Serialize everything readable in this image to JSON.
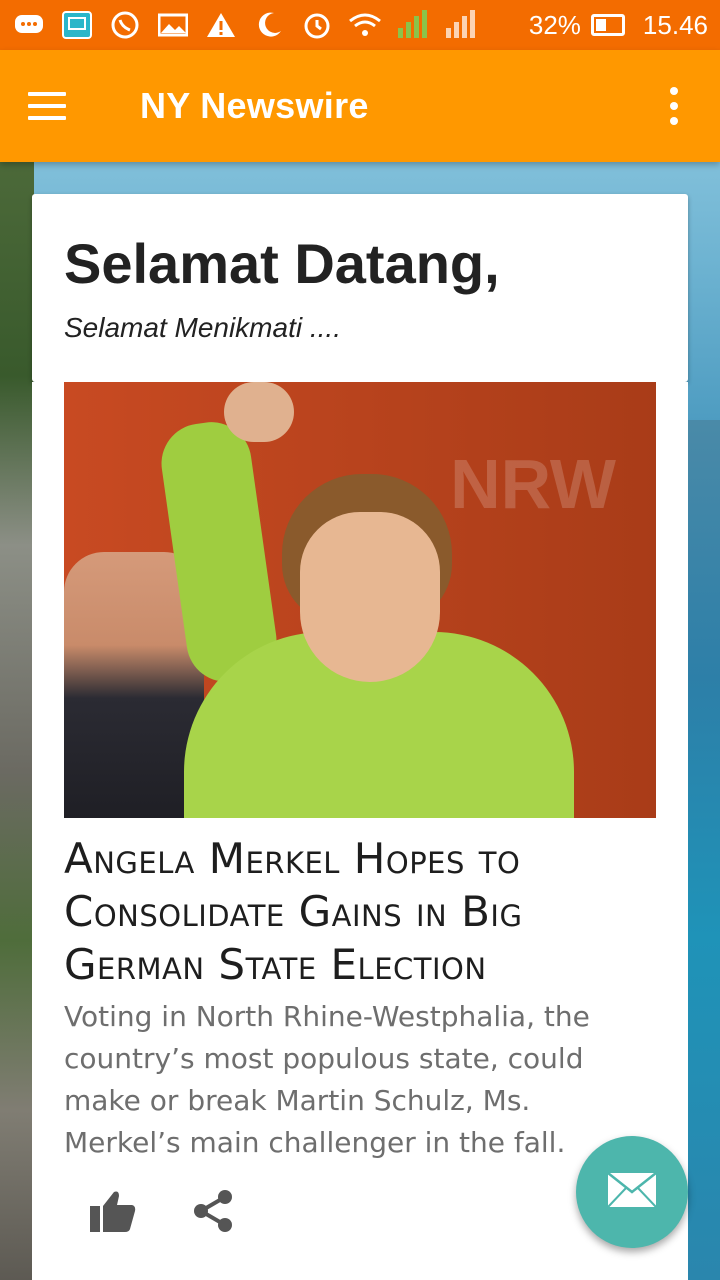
{
  "status_bar": {
    "battery": "32%",
    "time": "15.46",
    "icons": [
      "chat-icon",
      "screen-icon",
      "whatsapp-icon",
      "gallery-icon",
      "warning-icon",
      "moon-icon",
      "alarm-icon",
      "wifi-icon",
      "signal-icon",
      "signal-off-icon",
      "battery-charging-icon"
    ]
  },
  "app_bar": {
    "title": "NY Newswire"
  },
  "welcome": {
    "heading": "Selamat Datang,",
    "subheading": "Selamat Menikmati ...."
  },
  "article": {
    "headline": "Angela Merkel Hopes to Consolidate Gains in Big German State Election",
    "summary": "Voting in North Rhine-Westphalia, the country’s most populous state, could make or break Martin Schulz, Ms. Merkel’s main challenger in the fall.",
    "image_text": "NRW"
  },
  "colors": {
    "status_bar": "#f36c00",
    "app_bar": "#ff9800",
    "fab": "#4db6ac"
  }
}
